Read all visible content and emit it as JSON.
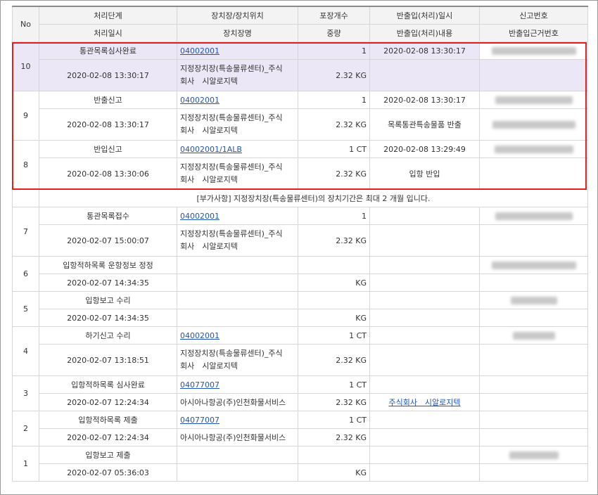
{
  "header": {
    "row1": [
      "No",
      "처리단계",
      "장치장/장치위치",
      "포장개수",
      "반출입(처리)일시",
      "신고번호"
    ],
    "row2": [
      "처리일시",
      "장치장명",
      "중량",
      "반출입(처리)내용",
      "반출입근거번호"
    ]
  },
  "notice": "[부가사항] 지정장치장(특송물류센터)의 장치기간은 최대 2 개월 입니다.",
  "rows": [
    {
      "no": "10",
      "stage": "통관목록심사완료",
      "location": "04002001",
      "pkg": "1",
      "io_time": "2020-02-08 13:30:17",
      "time": "2020-02-08 13:30:17",
      "name1": "지정장치장(특송물류센터)_주식",
      "name2": "회사　시알로지텍",
      "weight": "2.32 KG",
      "content": ""
    },
    {
      "no": "9",
      "stage": "반출신고",
      "location": "04002001",
      "pkg": "1",
      "io_time": "2020-02-08 13:30:17",
      "time": "2020-02-08 13:30:17",
      "name1": "지정장치장(특송물류센터)_주식",
      "name2": "회사　시알로지텍",
      "weight": "2.32 KG",
      "content": "목록통관특송물품 반출"
    },
    {
      "no": "8",
      "stage": "반입신고",
      "location": "04002001/1ALB",
      "pkg": "1 CT",
      "io_time": "2020-02-08 13:29:49",
      "time": "2020-02-08 13:30:06",
      "name1": "지정장치장(특송물류센터)_주식",
      "name2": "회사　시알로지텍",
      "weight": "2.32 KG",
      "content": "입항 반입"
    },
    {
      "no": "7",
      "stage": "통관목록접수",
      "location": "04002001",
      "pkg": "1",
      "io_time": "",
      "time": "2020-02-07 15:00:07",
      "name1": "지정장치장(특송물류센터)_주식",
      "name2": "회사　시알로지텍",
      "weight": "2.32 KG",
      "content": ""
    },
    {
      "no": "6",
      "stage": "입항적하목록 운항정보 정정",
      "location": "",
      "pkg": "",
      "io_time": "",
      "time": "2020-02-07 14:34:35",
      "name1": "",
      "name2": "",
      "weight": "KG",
      "content": ""
    },
    {
      "no": "5",
      "stage": "입항보고 수리",
      "location": "",
      "pkg": "",
      "io_time": "",
      "time": "2020-02-07 14:34:35",
      "name1": "",
      "name2": "",
      "weight": "KG",
      "content": ""
    },
    {
      "no": "4",
      "stage": "하기신고 수리",
      "location": "04002001",
      "pkg": "1 CT",
      "io_time": "",
      "time": "2020-02-07 13:18:51",
      "name1": "지정장치장(특송물류센터)_주식",
      "name2": "회사　시알로지텍",
      "weight": "2.32 KG",
      "content": ""
    },
    {
      "no": "3",
      "stage": "입항적하목록 심사완료",
      "location": "04077007",
      "pkg": "1 CT",
      "io_time": "",
      "time": "2020-02-07 12:24:34",
      "name1": "아시아나항공(주)인천화물서비스",
      "name2": "",
      "weight": "2.32 KG",
      "content": "주식회사　시알로지텍"
    },
    {
      "no": "2",
      "stage": "입항적하목록 제출",
      "location": "04077007",
      "pkg": "1 CT",
      "io_time": "",
      "time": "2020-02-07 12:24:34",
      "name1": "아시아나항공(주)인천화물서비스",
      "name2": "",
      "weight": "2.32 KG",
      "content": ""
    },
    {
      "no": "1",
      "stage": "입항보고 제출",
      "location": "",
      "pkg": "",
      "io_time": "",
      "time": "2020-02-07 05:36:03",
      "name1": "",
      "name2": "",
      "weight": "KG",
      "content": ""
    }
  ]
}
